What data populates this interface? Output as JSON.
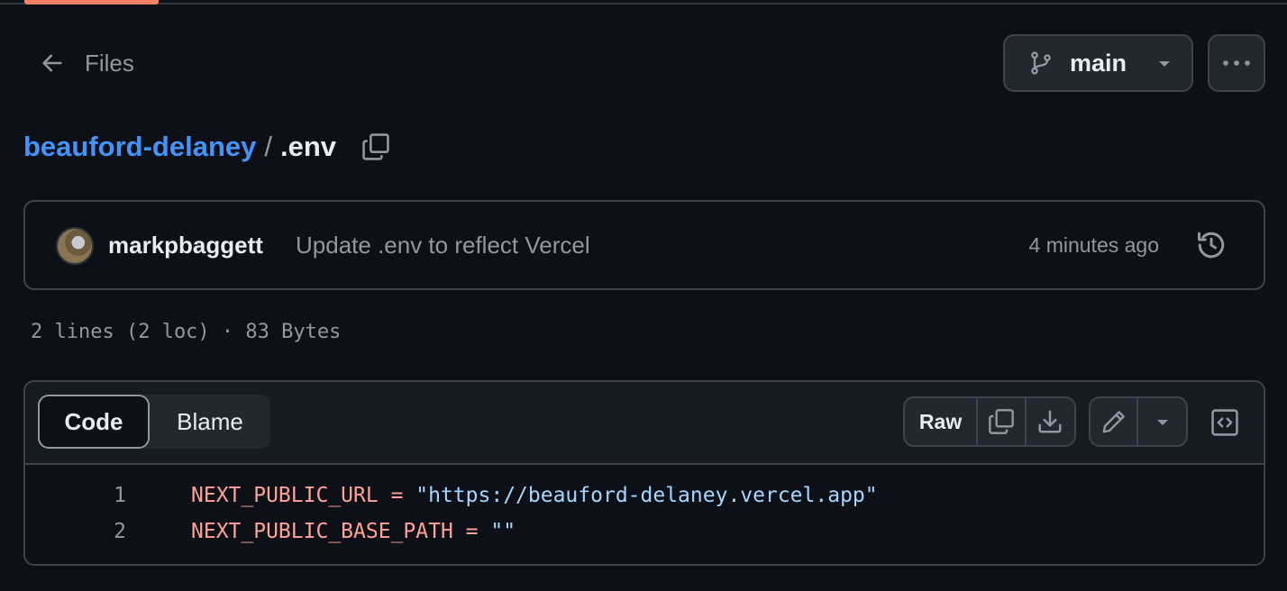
{
  "nav": {
    "back_label": "Files",
    "branch": "main"
  },
  "breadcrumb": {
    "repo": "beauford-delaney",
    "separator": "/",
    "file": ".env"
  },
  "commit": {
    "author": "markpbaggett",
    "message": "Update .env to reflect Vercel",
    "time": "4 minutes ago"
  },
  "file_meta": "2 lines (2 loc) · 83 Bytes",
  "view_tabs": {
    "code": "Code",
    "blame": "Blame"
  },
  "toolbar": {
    "raw": "Raw"
  },
  "code": {
    "lines": [
      {
        "number": "1",
        "key": "NEXT_PUBLIC_URL",
        "op": " = ",
        "value": "\"https://beauford-delaney.vercel.app\""
      },
      {
        "number": "2",
        "key": "NEXT_PUBLIC_BASE_PATH",
        "op": " = ",
        "value": "\"\""
      }
    ]
  },
  "colors": {
    "background": "#0d1117",
    "accent_tab": "#f78166",
    "link": "#4493f8",
    "env_key": "#ffa198",
    "string": "#a5d6ff"
  },
  "icons": [
    "arrow-left-icon",
    "git-branch-icon",
    "triangle-down-icon",
    "kebab-horizontal-icon",
    "copy-icon",
    "history-icon",
    "download-icon",
    "pencil-icon",
    "code-square-icon"
  ]
}
